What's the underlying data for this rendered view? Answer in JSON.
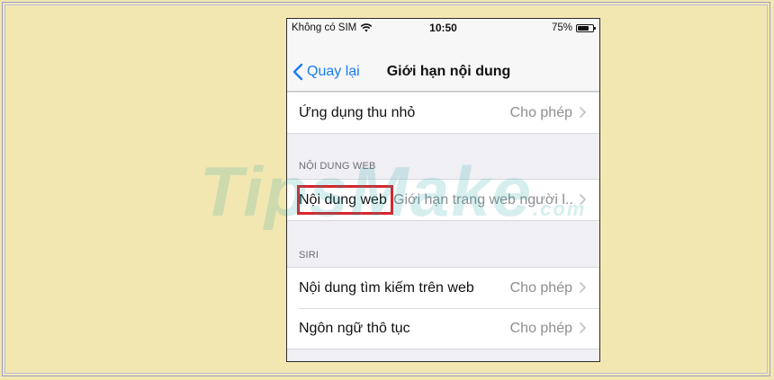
{
  "status_bar": {
    "carrier": "Không có SIM",
    "time": "10:50",
    "battery": "75%",
    "battery_level": 0.75
  },
  "nav": {
    "back_label": "Quay lại",
    "title": "Giới hạn nội dung"
  },
  "rows_top": [
    {
      "label": "Ứng dụng thu nhỏ",
      "value": "Cho phép"
    }
  ],
  "web_section": {
    "header": "NỘI DUNG WEB",
    "row": {
      "label": "Nội dung web",
      "value": "Giới hạn trang web người l..."
    }
  },
  "siri_section": {
    "header": "SIRI",
    "rows": [
      {
        "label": "Nội dung tìm kiếm trên web",
        "value": "Cho phép"
      },
      {
        "label": "Ngôn ngữ thô tục",
        "value": "Cho phép"
      }
    ]
  },
  "watermark": {
    "text": "TipsMake",
    "suffix": ".com"
  }
}
